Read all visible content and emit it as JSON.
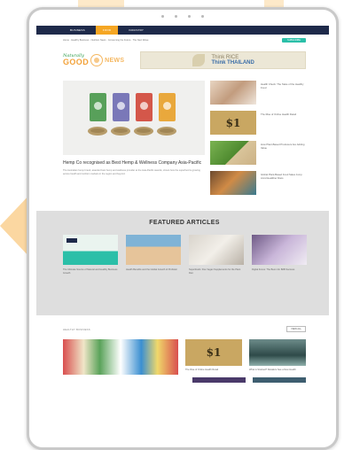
{
  "nav": {
    "items": [
      {
        "label": "BUSINESS",
        "active": false
      },
      {
        "label": "FOOD",
        "active": true
      },
      {
        "label": "INDUSTRY",
        "active": false
      }
    ]
  },
  "breadcrumb": "Home · Healthy Business · Nutrition News · Consuming the Future · The Next Wave",
  "subscribe_label": "SUBSCRIBE",
  "logo": {
    "small": "Naturally",
    "big": "GOOD",
    "news": "NEWS"
  },
  "ad": {
    "line1": "Think RICE",
    "line2": "Think THAILAND"
  },
  "hero": {
    "title": "Hemp Co recognised as Best Hemp & Wellness Company Asia-Pacific",
    "excerpt": "The Australian hemp brand, awarded best hemp and wellness provider at the Asia-Pacific awards, shows how the superfood is growing across health and nutrition markets in the region and beyond."
  },
  "side_items": [
    {
      "text": "Health Check: The State of the Healthy Food",
      "thumb": "hands"
    },
    {
      "text": "The Rise of Online Health Retail",
      "thumb": "gold"
    },
    {
      "text": "How Plant-Based Producers Are Adding Value",
      "thumb": "grass"
    },
    {
      "text": "Global Plant-Based Food Sales Jump Amid Healthier Diets",
      "thumb": "food"
    }
  ],
  "featured": {
    "title": "FEATURED ARTICLES",
    "cards": [
      {
        "text": "The Ultimate Source of Natural and Healthy Business Growth",
        "thumb": "green"
      },
      {
        "text": "Health Benefits and the Global Growth of Probiotic",
        "thumb": "beach"
      },
      {
        "text": "Superfoods: Five Vegan Supplements for the Plant Diet",
        "thumb": "notes"
      },
      {
        "text": "Digital Focus: The Boom for B2B Success",
        "thumb": "purple"
      }
    ]
  },
  "bottom": {
    "label": "HEALTHY BUSINESS",
    "view_all": "VIEW ALL",
    "cards": [
      {
        "text": "The Rise of Online Health Retail",
        "thumb": "gold"
      },
      {
        "text": "What is Stocked? Retailers See a New Health",
        "thumb": "store"
      }
    ]
  },
  "colors": {
    "nav": "#1e2a4a",
    "accent_orange": "#f5a623",
    "teal": "#2bbfa8",
    "featured_bg": "#dedede",
    "deco_orange": "#fbd7a1"
  },
  "icons": {
    "logo_mark": "sun-circle-icon",
    "ad_mark": "leaf-icon"
  }
}
